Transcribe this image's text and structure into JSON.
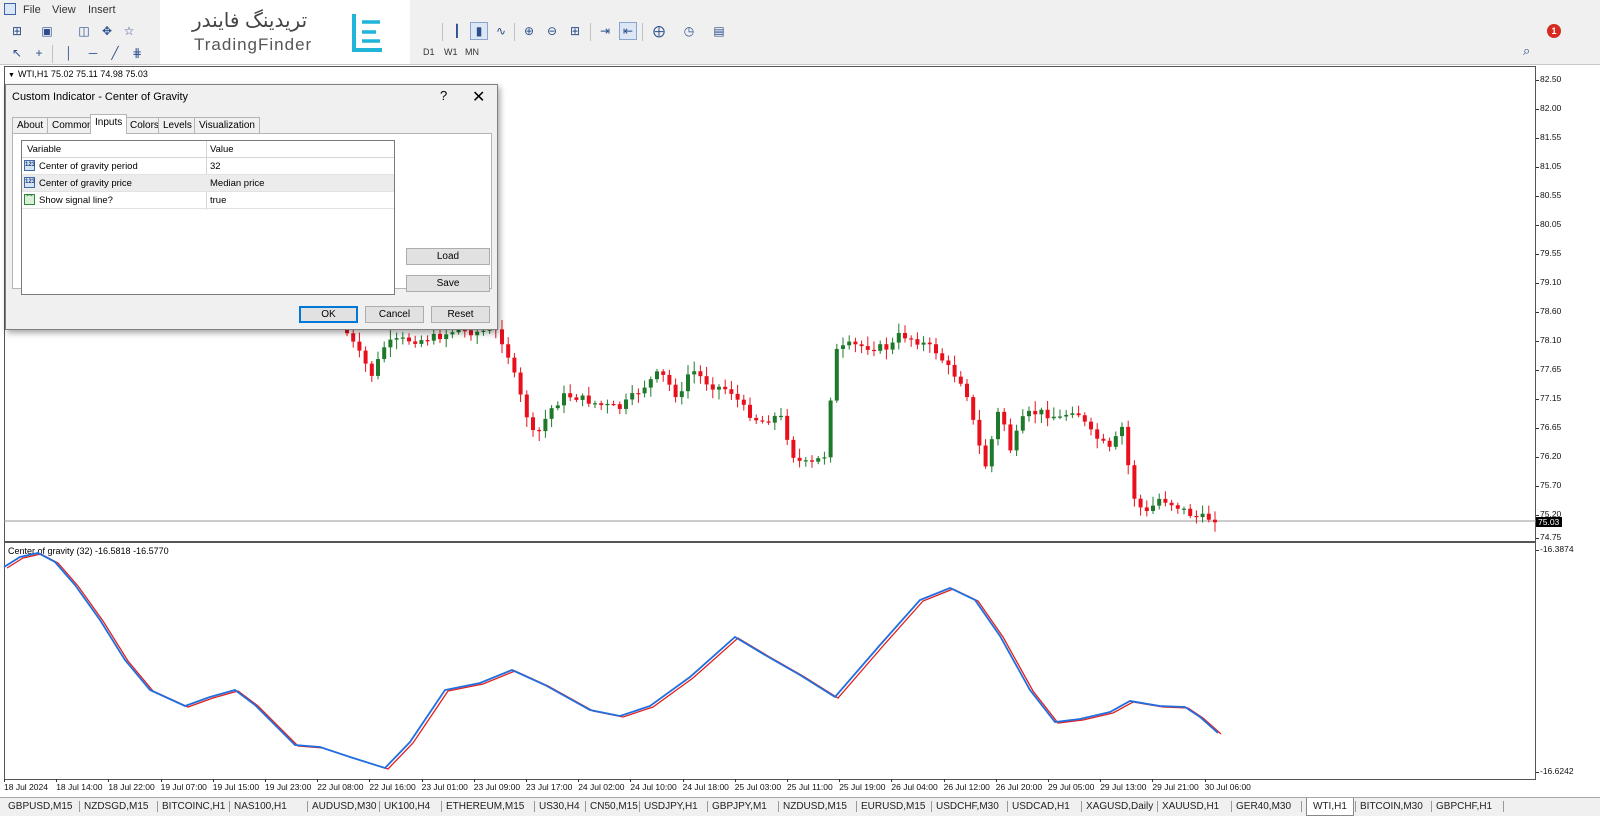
{
  "menu": {
    "items": [
      "File",
      "View",
      "Insert"
    ]
  },
  "toolbar": {
    "timeframes": [
      "D1",
      "W1",
      "MN"
    ],
    "notification_count": "1"
  },
  "logo": {
    "persian": "تریدینگ فایندر",
    "english": "TradingFinder"
  },
  "chart": {
    "symbol_label": "WTI,H1  75.02 75.11 74.98 75.03",
    "current_price": "75.03",
    "price_ticks": [
      "82.50",
      "82.00",
      "81.55",
      "81.05",
      "80.55",
      "80.05",
      "79.55",
      "79.10",
      "78.60",
      "78.10",
      "77.65",
      "77.15",
      "76.65",
      "76.20",
      "75.70",
      "75.20",
      "74.75"
    ],
    "indicator_label": "Center of gravity (32) -16.5818 -16.5770",
    "indicator_ticks": [
      "-16.3874",
      "-16.6242"
    ],
    "time_ticks": [
      "18 Jul 2024",
      "18 Jul 14:00",
      "18 Jul 22:00",
      "19 Jul 07:00",
      "19 Jul 15:00",
      "19 Jul 23:00",
      "22 Jul 08:00",
      "22 Jul 16:00",
      "23 Jul 01:00",
      "23 Jul 09:00",
      "23 Jul 17:00",
      "24 Jul 02:00",
      "24 Jul 10:00",
      "24 Jul 18:00",
      "25 Jul 03:00",
      "25 Jul 11:00",
      "25 Jul 19:00",
      "26 Jul 04:00",
      "26 Jul 12:00",
      "26 Jul 20:00",
      "29 Jul 05:00",
      "29 Jul 13:00",
      "29 Jul 21:00",
      "30 Jul 06:00"
    ],
    "colors": {
      "bull": "#1e7a2a",
      "bear": "#e8101c",
      "cog_line": "#1f6fe0",
      "signal_line": "#e02020"
    }
  },
  "dialog": {
    "title": "Custom Indicator - Center of Gravity",
    "help": "?",
    "close": "✕",
    "tabs": [
      "About",
      "Common",
      "Inputs",
      "Colors",
      "Levels",
      "Visualization"
    ],
    "active_tab": "Inputs",
    "columns": [
      "Variable",
      "Value"
    ],
    "rows": [
      {
        "icon": "number-icon",
        "variable": "Center of gravity period",
        "value": "32"
      },
      {
        "icon": "number-icon",
        "variable": "Center of gravity price",
        "value": "Median price"
      },
      {
        "icon": "bool-chart-icon",
        "variable": "Show signal line?",
        "value": "true"
      }
    ],
    "buttons": {
      "load": "Load",
      "save": "Save",
      "ok": "OK",
      "cancel": "Cancel",
      "reset": "Reset"
    }
  },
  "symbol_tabs": [
    "GBPUSD,M15",
    "NZDSGD,M15",
    "BITCOINC,H1",
    "NAS100,H1",
    "AUDUSD,M30",
    "UK100,H4",
    "ETHEREUM,M15",
    "US30,H4",
    "CN50,M15",
    "USDJPY,H1",
    "GBPJPY,M1",
    "NZDUSD,M15",
    "EURUSD,M15",
    "USDCHF,M30",
    "USDCAD,H1",
    "XAGUSD,Daily",
    "XAUUSD,H1",
    "GER40,M30",
    "WTI,H1",
    "BITCOIN,M30",
    "GBPCHF,H1"
  ],
  "active_symbol_tab": "WTI,H1"
}
